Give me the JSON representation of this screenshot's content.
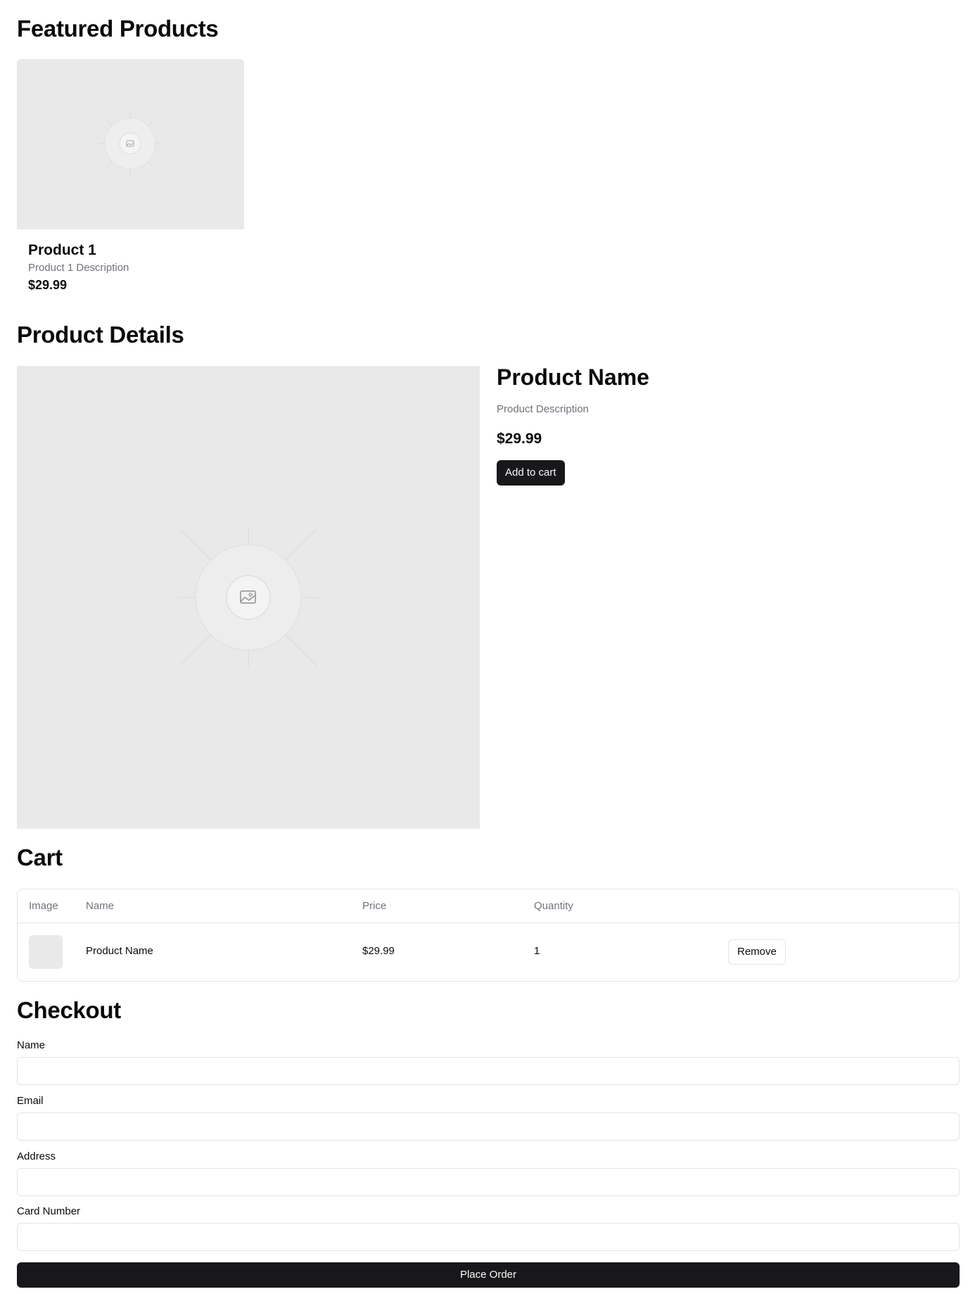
{
  "featured": {
    "heading": "Featured Products",
    "products": [
      {
        "title": "Product 1",
        "description": "Product 1 Description",
        "price": "$29.99",
        "image_icon": "image-placeholder-icon"
      }
    ]
  },
  "details": {
    "heading": "Product Details",
    "name": "Product Name",
    "description": "Product Description",
    "price": "$29.99",
    "add_to_cart_label": "Add to cart",
    "image_icon": "image-placeholder-icon"
  },
  "cart": {
    "heading": "Cart",
    "columns": [
      "Image",
      "Name",
      "Price",
      "Quantity"
    ],
    "rows": [
      {
        "name": "Product Name",
        "price": "$29.99",
        "quantity": "1",
        "remove_label": "Remove"
      }
    ]
  },
  "checkout": {
    "heading": "Checkout",
    "fields": [
      {
        "label": "Name",
        "value": ""
      },
      {
        "label": "Email",
        "value": ""
      },
      {
        "label": "Address",
        "value": ""
      },
      {
        "label": "Card Number",
        "value": ""
      }
    ],
    "submit_label": "Place Order"
  },
  "colors": {
    "primary": "#18181b",
    "muted_text": "#71717a",
    "border": "#e4e4e7",
    "placeholder_bg": "#e9e9e9"
  }
}
